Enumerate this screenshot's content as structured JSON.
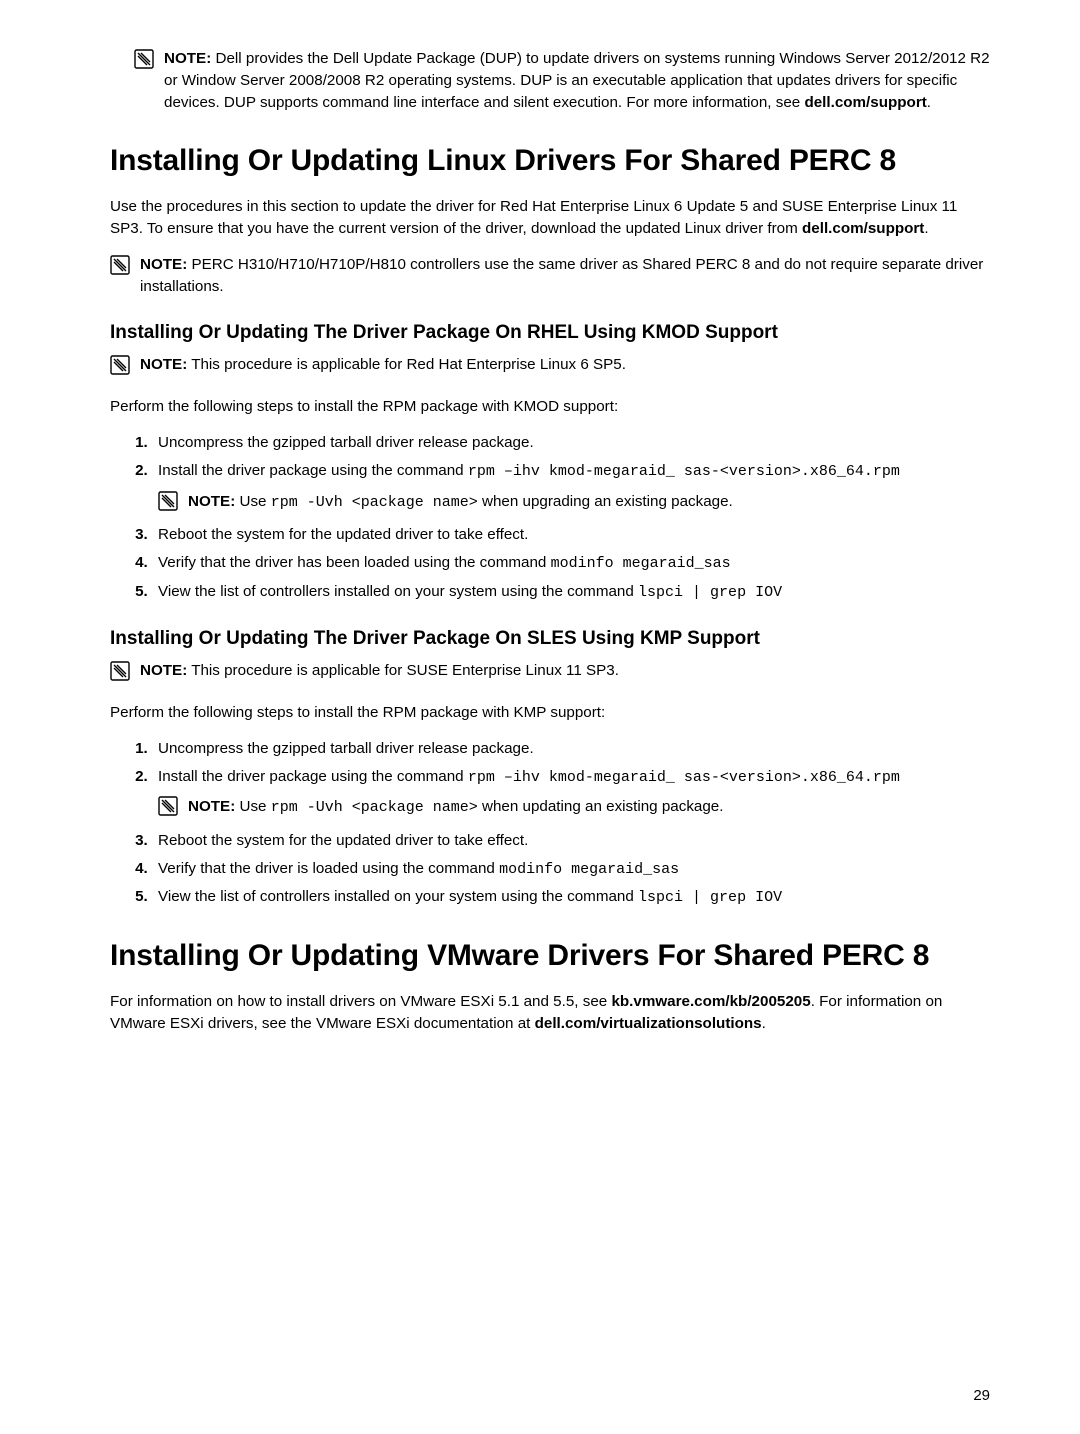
{
  "note_label": "NOTE:",
  "top_note": "Dell provides the Dell Update Package (DUP) to update drivers on systems running Windows Server 2012/2012 R2 or Window Server 2008/2008 R2 operating systems. DUP is an executable application that updates drivers for specific devices. DUP supports command line interface and silent execution. For more information, see ",
  "top_note_bold": "dell.com/support",
  "top_note_tail": ".",
  "h1_linux": "Installing Or Updating Linux Drivers For Shared PERC 8",
  "linux_intro_1": "Use the procedures in this section to update the driver for Red Hat Enterprise Linux 6 Update 5 and SUSE Enterprise Linux 11 SP3. To ensure that you have the current version of the driver, download the updated Linux driver from ",
  "linux_intro_bold": "dell.com/support",
  "linux_intro_tail": ".",
  "linux_note": "PERC H310/H710/H710P/H810 controllers use the same driver as Shared PERC 8 and do not require separate driver installations.",
  "h2_rhel": "Installing Or Updating The Driver Package On RHEL Using KMOD Support",
  "rhel_note": "This procedure is applicable for Red Hat Enterprise Linux 6 SP5.",
  "rhel_perform": "Perform the following steps to install the RPM package with KMOD support:",
  "rhel_step1": "Uncompress the gzipped tarball driver release package.",
  "rhel_step2_a": "Install the driver package using the command ",
  "rhel_step2_code": "rpm –ihv kmod-megaraid_ sas-<version>.x86_64.rpm",
  "rhel_step2_note_a": "Use ",
  "rhel_step2_note_code": "rpm -Uvh <package name>",
  "rhel_step2_note_b": " when upgrading an existing package.",
  "rhel_step3": "Reboot the system for the updated driver to take effect.",
  "rhel_step4_a": "Verify that the driver has been loaded using the command ",
  "rhel_step4_code": "modinfo megaraid_sas",
  "rhel_step5_a": "View the list of controllers installed on your system using the command ",
  "rhel_step5_code": "lspci | grep IOV",
  "h2_sles": "Installing Or Updating The Driver Package On SLES Using KMP Support",
  "sles_note": "This procedure is applicable for SUSE Enterprise Linux 11 SP3.",
  "sles_perform": "Perform the following steps to install the RPM package with KMP support:",
  "sles_step1": "Uncompress the gzipped tarball driver release package.",
  "sles_step2_a": "Install the driver package using the command ",
  "sles_step2_code": "rpm –ihv kmod-megaraid_ sas-<version>.x86_64.rpm",
  "sles_step2_note_a": "Use ",
  "sles_step2_note_code": "rpm -Uvh <package name>",
  "sles_step2_note_b": " when updating an existing package.",
  "sles_step3": "Reboot the system for the updated driver to take effect.",
  "sles_step4_a": "Verify that the driver is loaded using the command ",
  "sles_step4_code": "modinfo megaraid_sas",
  "sles_step5_a": "View the list of controllers installed on your system using the command ",
  "sles_step5_code": "lspci | grep IOV",
  "h1_vmware": "Installing Or Updating VMware Drivers For Shared PERC 8",
  "vmware_body_1": "For information on how to install drivers on VMware ESXi 5.1 and 5.5, see ",
  "vmware_bold_1": "kb.vmware.com/kb/2005205",
  "vmware_body_2": ". For information on VMware ESXi drivers, see the VMware ESXi documentation at ",
  "vmware_bold_2": "dell.com/virtualizationsolutions",
  "vmware_body_3": ".",
  "page_number": "29"
}
